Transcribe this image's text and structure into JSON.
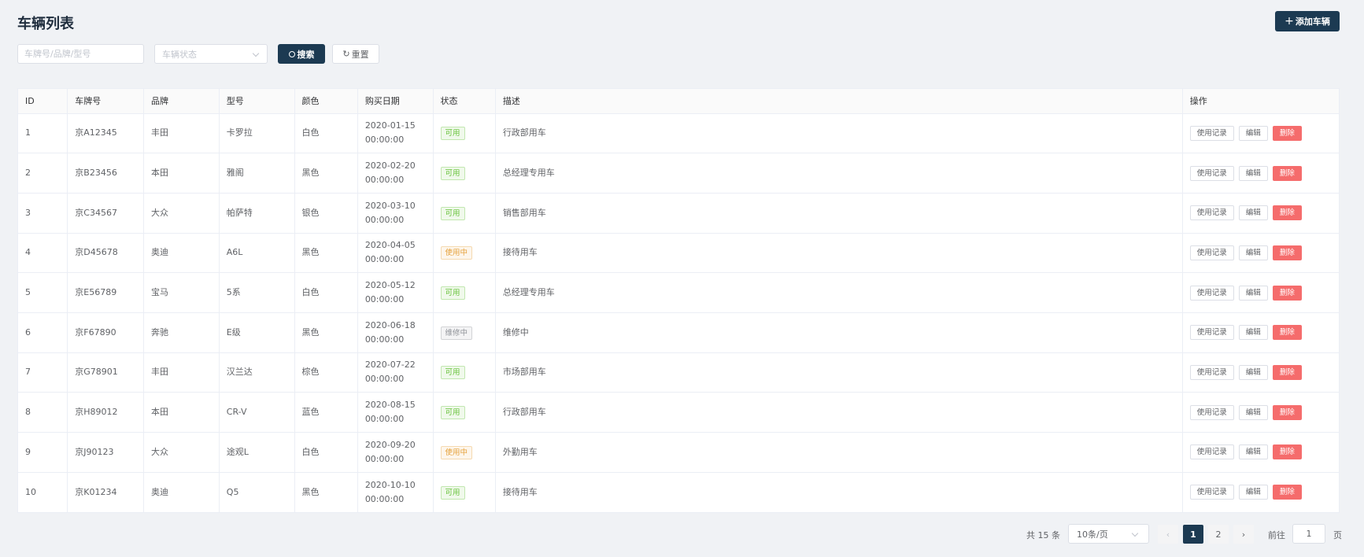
{
  "header": {
    "title": "车辆列表",
    "add_button": "添加车辆"
  },
  "filters": {
    "keyword_placeholder": "车牌号/品牌/型号",
    "status_placeholder": "车辆状态",
    "search_button": "搜索",
    "reset_button": "重置"
  },
  "table": {
    "columns": [
      "ID",
      "车牌号",
      "品牌",
      "型号",
      "颜色",
      "购买日期",
      "状态",
      "描述",
      "操作"
    ],
    "rows": [
      {
        "id": "1",
        "plate": "京A12345",
        "brand": "丰田",
        "model": "卡罗拉",
        "color": "白色",
        "date": "2020-01-15",
        "time": "00:00:00",
        "status": "可用",
        "status_type": "green",
        "desc": "行政部用车"
      },
      {
        "id": "2",
        "plate": "京B23456",
        "brand": "本田",
        "model": "雅阁",
        "color": "黑色",
        "date": "2020-02-20",
        "time": "00:00:00",
        "status": "可用",
        "status_type": "green",
        "desc": "总经理专用车"
      },
      {
        "id": "3",
        "plate": "京C34567",
        "brand": "大众",
        "model": "帕萨特",
        "color": "银色",
        "date": "2020-03-10",
        "time": "00:00:00",
        "status": "可用",
        "status_type": "green",
        "desc": "销售部用车"
      },
      {
        "id": "4",
        "plate": "京D45678",
        "brand": "奥迪",
        "model": "A6L",
        "color": "黑色",
        "date": "2020-04-05",
        "time": "00:00:00",
        "status": "使用中",
        "status_type": "orange",
        "desc": "接待用车"
      },
      {
        "id": "5",
        "plate": "京E56789",
        "brand": "宝马",
        "model": "5系",
        "color": "白色",
        "date": "2020-05-12",
        "time": "00:00:00",
        "status": "可用",
        "status_type": "green",
        "desc": "总经理专用车"
      },
      {
        "id": "6",
        "plate": "京F67890",
        "brand": "奔驰",
        "model": "E级",
        "color": "黑色",
        "date": "2020-06-18",
        "time": "00:00:00",
        "status": "维修中",
        "status_type": "gray",
        "desc": "维修中"
      },
      {
        "id": "7",
        "plate": "京G78901",
        "brand": "丰田",
        "model": "汉兰达",
        "color": "棕色",
        "date": "2020-07-22",
        "time": "00:00:00",
        "status": "可用",
        "status_type": "green",
        "desc": "市场部用车"
      },
      {
        "id": "8",
        "plate": "京H89012",
        "brand": "本田",
        "model": "CR-V",
        "color": "蓝色",
        "date": "2020-08-15",
        "time": "00:00:00",
        "status": "可用",
        "status_type": "green",
        "desc": "行政部用车"
      },
      {
        "id": "9",
        "plate": "京J90123",
        "brand": "大众",
        "model": "途观L",
        "color": "白色",
        "date": "2020-09-20",
        "time": "00:00:00",
        "status": "使用中",
        "status_type": "orange",
        "desc": "外勤用车"
      },
      {
        "id": "10",
        "plate": "京K01234",
        "brand": "奥迪",
        "model": "Q5",
        "color": "黑色",
        "date": "2020-10-10",
        "time": "00:00:00",
        "status": "可用",
        "status_type": "green",
        "desc": "接待用车"
      }
    ],
    "actions": {
      "records": "使用记录",
      "edit": "编辑",
      "delete": "删除"
    }
  },
  "pagination": {
    "total": "共 15 条",
    "page_size": "10条/页",
    "prev": "‹",
    "pages": [
      "1",
      "2"
    ],
    "next": "›",
    "jump_label": "前往",
    "jump_value": "1",
    "jump_suffix": "页"
  },
  "colors": {
    "primary": "#1c3a52",
    "danger": "#f56c6c",
    "success": "#67c23a",
    "warning": "#e6a23c",
    "info": "#909399"
  }
}
